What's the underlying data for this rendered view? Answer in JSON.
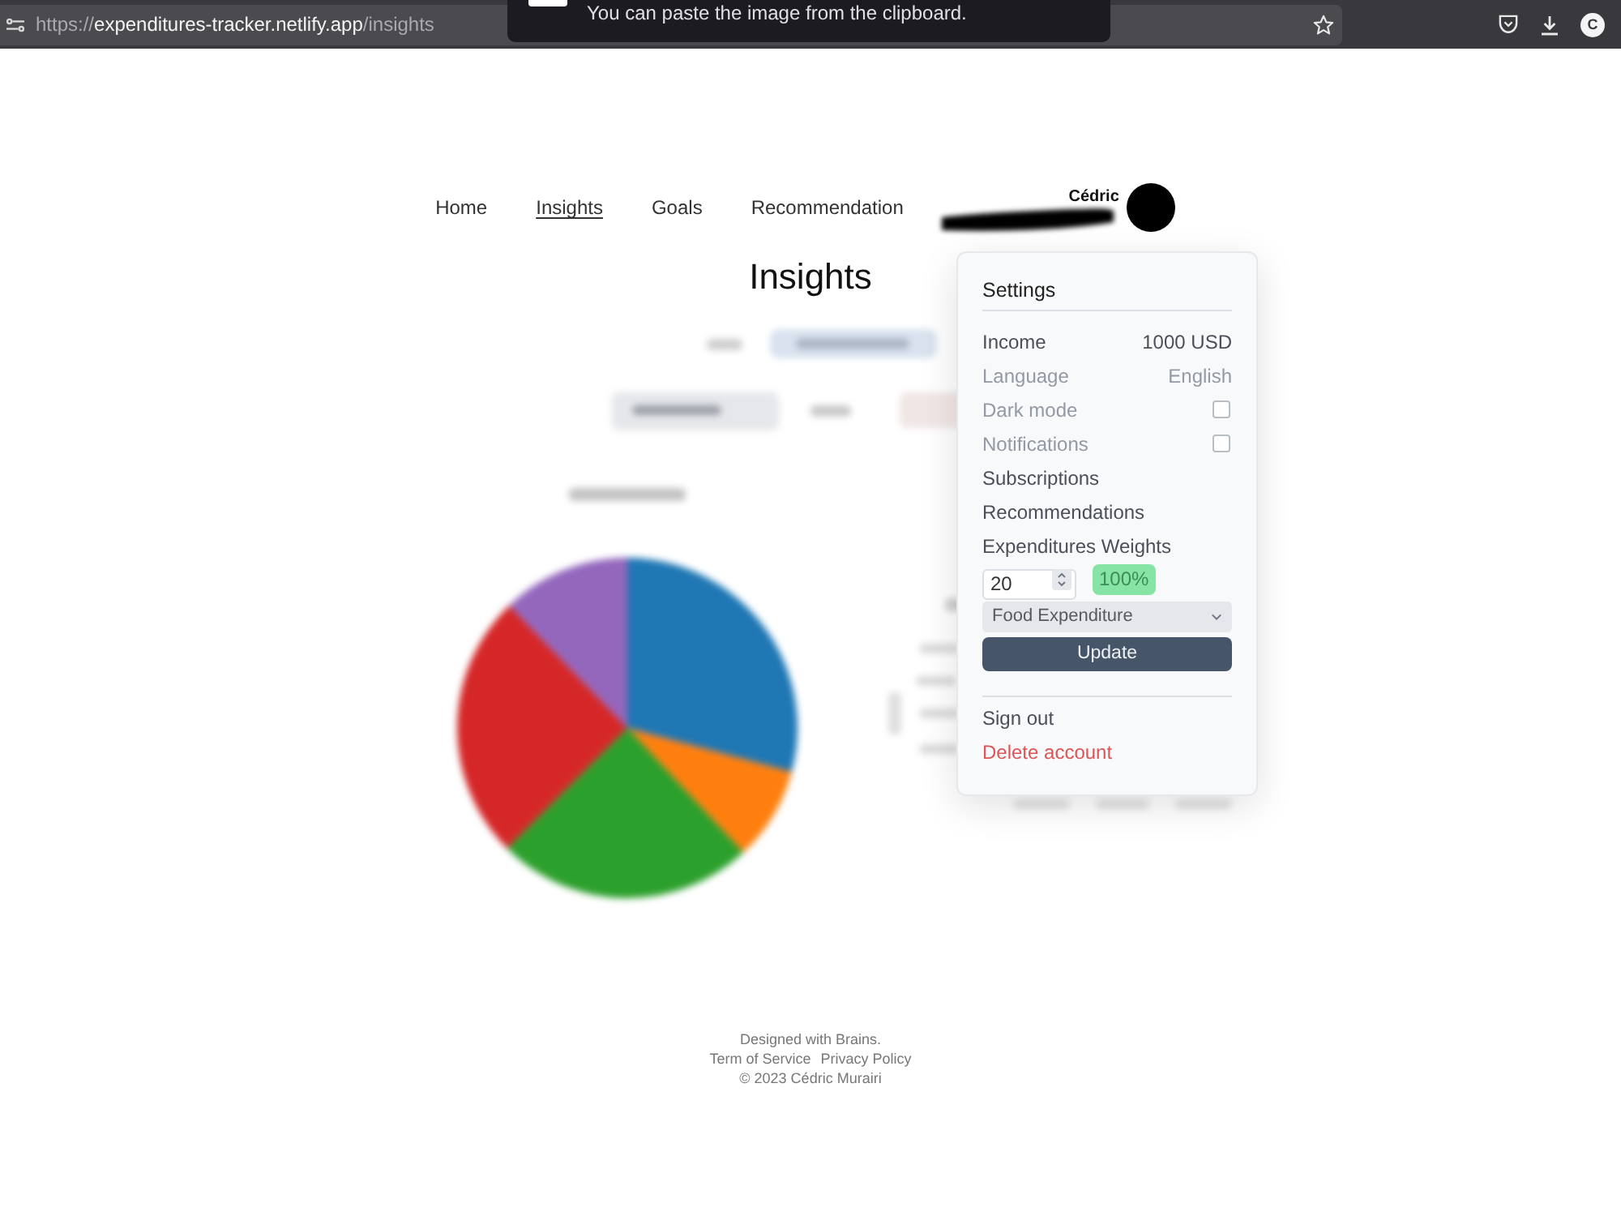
{
  "browser": {
    "url_prefix": "https://",
    "url_host": "expenditures-tracker.netlify.app",
    "url_path": "/insights",
    "account_initial": "C"
  },
  "toast": {
    "message": "You can paste the image from the clipboard."
  },
  "nav": {
    "links": [
      {
        "label": "Home",
        "selected": false
      },
      {
        "label": "Insights",
        "selected": true
      },
      {
        "label": "Goals",
        "selected": false
      },
      {
        "label": "Recommendation",
        "selected": false
      }
    ],
    "user_name": "Cédric"
  },
  "page": {
    "title": "Insights"
  },
  "settings_menu": {
    "title": "Settings",
    "rows": [
      {
        "kind": "value",
        "label": "Income",
        "value": "1000 USD",
        "disabled": false
      },
      {
        "kind": "value",
        "label": "Language",
        "value": "English",
        "disabled": true
      },
      {
        "kind": "checkbox",
        "label": "Dark mode",
        "checked": false,
        "disabled": true
      },
      {
        "kind": "checkbox",
        "label": "Notifications",
        "checked": false,
        "disabled": true
      },
      {
        "kind": "link",
        "label": "Subscriptions",
        "disabled": false
      },
      {
        "kind": "link",
        "label": "Recommendations",
        "disabled": false
      },
      {
        "kind": "label",
        "label": "Expenditures Weights",
        "disabled": false
      }
    ],
    "weights": {
      "value": "20",
      "total": "100%",
      "category": "Food Expenditure",
      "button": "Update"
    },
    "actions": [
      {
        "label": "Sign out",
        "kind": "normal"
      },
      {
        "label": "Delete account",
        "kind": "danger"
      }
    ]
  },
  "footer": {
    "tagline": "Designed with Brains.",
    "links": [
      "Term of Service",
      "Privacy Policy"
    ],
    "copyright": "© 2023 Cédric Murairi"
  }
}
